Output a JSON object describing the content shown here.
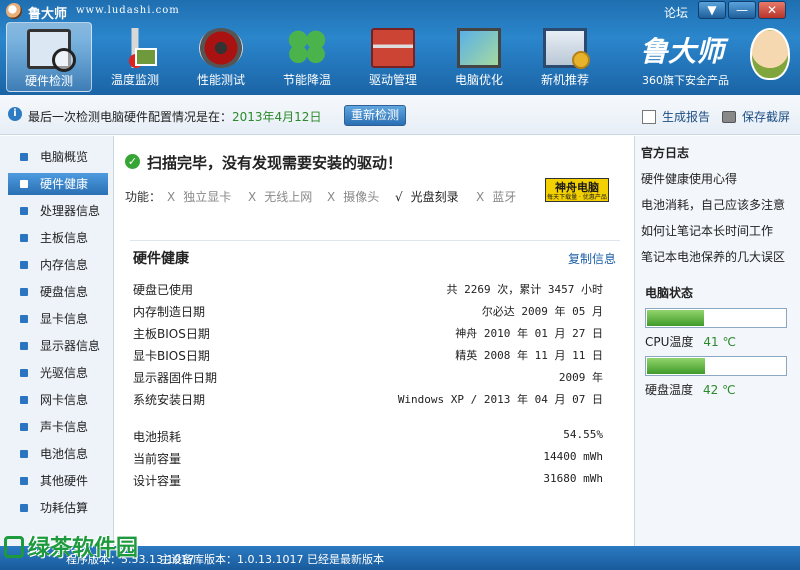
{
  "app": {
    "title": "鲁大师",
    "url": "www.ludashi.com",
    "forum": "论坛"
  },
  "toolbar": [
    {
      "label": "硬件检测",
      "icon": "hardware-scan-icon",
      "active": true
    },
    {
      "label": "温度监测",
      "icon": "thermometer-icon"
    },
    {
      "label": "性能测试",
      "icon": "performance-gauge-icon"
    },
    {
      "label": "节能降温",
      "icon": "clover-icon"
    },
    {
      "label": "驱动管理",
      "icon": "toolbox-icon"
    },
    {
      "label": "电脑优化",
      "icon": "screen-optimize-icon"
    },
    {
      "label": "新机推荐",
      "icon": "pc-medal-icon"
    }
  ],
  "brand": {
    "name": "鲁大师",
    "tagline": "360旗下安全产品"
  },
  "infobar": {
    "text": "最后一次检测电脑硬件配置情况是在：",
    "date": "2013年4月12日",
    "recheck": "重新检测",
    "report": "生成报告",
    "screenshot": "保存截屏"
  },
  "sidebar": {
    "items": [
      "电脑概览",
      "硬件健康",
      "处理器信息",
      "主板信息",
      "内存信息",
      "硬盘信息",
      "显卡信息",
      "显示器信息",
      "光驱信息",
      "网卡信息",
      "声卡信息",
      "电池信息",
      "其他硬件",
      "功耗估算"
    ],
    "active_index": 1
  },
  "main": {
    "scan_message": "扫描完毕，没有发现需要安装的驱动！",
    "features_label": "功能：",
    "features": [
      {
        "mark": "X",
        "label": "独立显卡",
        "ok": false
      },
      {
        "mark": "X",
        "label": "无线上网",
        "ok": false
      },
      {
        "mark": "X",
        "label": "摄像头",
        "ok": false
      },
      {
        "mark": "√",
        "label": "光盘刻录",
        "ok": true
      },
      {
        "mark": "X",
        "label": "蓝牙",
        "ok": false
      }
    ],
    "vendor_logo": {
      "name": "神舟电脑",
      "sub": "每天下载量 · 优惠产品"
    },
    "section_title": "硬件健康",
    "copy_info": "复制信息",
    "rows": [
      {
        "k": "硬盘已使用",
        "v": "共 2269 次，累计 3457 小时"
      },
      {
        "k": "内存制造日期",
        "v": "尔必达 2009 年 05 月"
      },
      {
        "k": "主板BIOS日期",
        "v": "神舟 2010 年 01 月 27 日"
      },
      {
        "k": "显卡BIOS日期",
        "v": "精英 2008 年 11 月 11 日"
      },
      {
        "k": "显示器固件日期",
        "v": "2009 年"
      },
      {
        "k": "系统安装日期",
        "v": "Windows XP / 2013 年 04 月 07 日"
      },
      {
        "k": "电池损耗",
        "v": "54.55%"
      },
      {
        "k": "当前容量",
        "v": "14400 mWh"
      },
      {
        "k": "设计容量",
        "v": "31680 mWh"
      }
    ]
  },
  "rpanel": {
    "title": "官方日志",
    "links": [
      "硬件健康使用心得",
      "电池消耗，自己应该多注意",
      "如何让笔记本长时间工作",
      "笔记本电池保养的几大误区"
    ],
    "status_title": "电脑状态",
    "cpu": {
      "label": "CPU温度",
      "value": "41 ℃",
      "level": 0.41
    },
    "disk": {
      "label": "硬盘温度",
      "value": "42 ℃",
      "level": 0.42
    }
  },
  "statusbar": {
    "version": "程序版本：5.53.13.1017",
    "db": "主设备库版本：1.0.13.1017    已经是最新版本"
  },
  "watermark": "绿茶软件园"
}
